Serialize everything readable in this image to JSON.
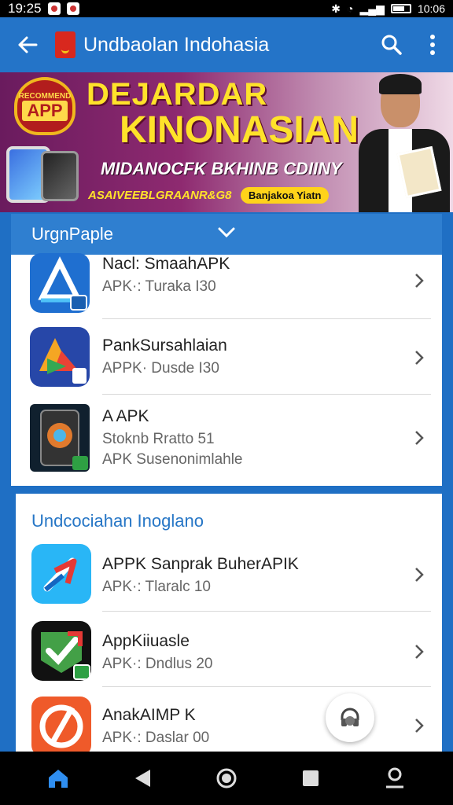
{
  "status": {
    "time": "19:25",
    "right_time": "10:06"
  },
  "app_bar": {
    "title": "Undbaolan Indohasia"
  },
  "banner": {
    "badge_small": "RECOMMEND",
    "badge_big": "APP",
    "headline1": "DEJARDAR",
    "headline2": "KINONASIAN",
    "subline": "MIDANOCFK BKHINB CDIINY",
    "footer": "ASAIVEEBLGRAANR&G8",
    "pill": "Banjakoa Yiatn"
  },
  "section1": {
    "header": "UrgnPaple",
    "items": [
      {
        "name": "Nacl: SmaahAPK",
        "sub": "APK·:  Turaka I30",
        "sub2": ""
      },
      {
        "name": "PankSursahlaian",
        "sub": "APPK· Dusde I30",
        "sub2": ""
      },
      {
        "name": "A APK",
        "sub": "Stoknb Rratto 51",
        "sub2": "APK Susenonimlahle"
      }
    ]
  },
  "section2": {
    "title": "Undcociahan Inoglano",
    "items": [
      {
        "name": "APPK Sanprak BuherAPIK",
        "sub": "APK·:  Tlaralc 10"
      },
      {
        "name": "AppKiiuasle",
        "sub": "APK·:  Dndlus 20"
      },
      {
        "name": "AnakAIMP K",
        "sub": "APK·:  Daslar 00"
      }
    ]
  },
  "colors": {
    "app_bar": "#2474c8",
    "accent": "#2676c6",
    "banner_yellow": "#ffe22a"
  }
}
